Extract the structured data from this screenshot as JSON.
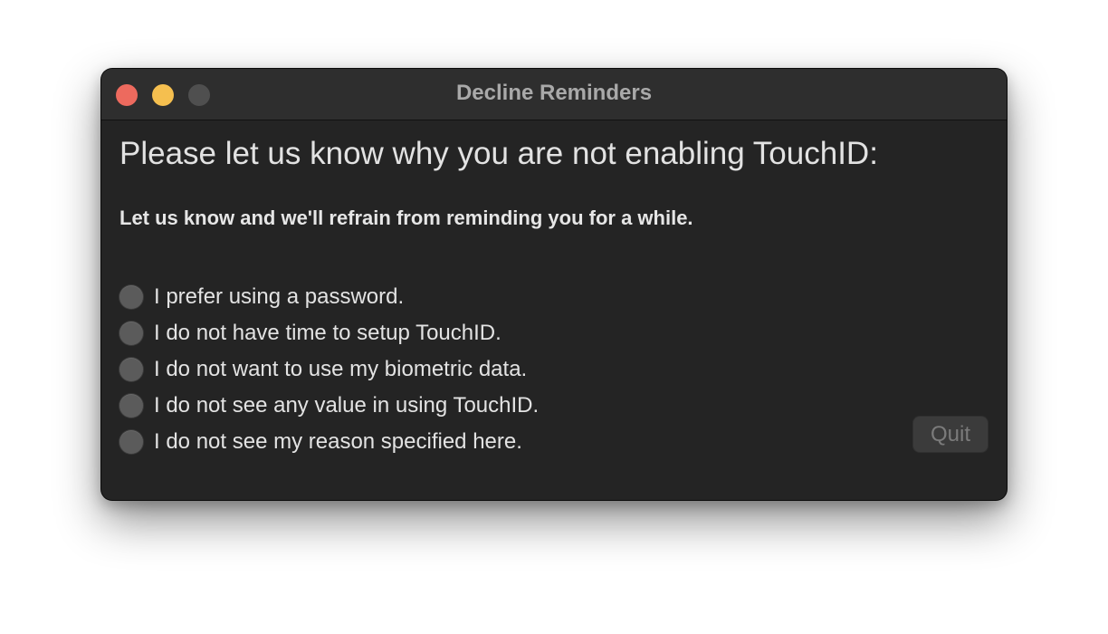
{
  "window": {
    "title": "Decline Reminders"
  },
  "traffic_lights": {
    "close": "close-button",
    "minimize": "minimize-button",
    "zoom": "zoom-button",
    "colors": {
      "close": "#ed6a5e",
      "minimize": "#f5bf4f",
      "zoom_disabled": "#4f4f4f"
    }
  },
  "content": {
    "heading": "Please let us know why you are not enabling TouchID:",
    "subheading": "Let us know and we'll refrain from reminding you for a while."
  },
  "options": [
    {
      "label": "I prefer using a password.",
      "selected": false
    },
    {
      "label": "I do not have time to setup TouchID.",
      "selected": false
    },
    {
      "label": "I do not want to use my biometric data.",
      "selected": false
    },
    {
      "label": "I do not see any value in using TouchID.",
      "selected": false
    },
    {
      "label": "I do not see my reason specified here.",
      "selected": false
    }
  ],
  "actions": {
    "quit_label": "Quit",
    "quit_enabled": false
  },
  "theme": {
    "window_bg": "#242424",
    "titlebar_bg": "#2e2e2e",
    "text": "#e3e3e3",
    "muted_text": "#a9a9a9"
  }
}
